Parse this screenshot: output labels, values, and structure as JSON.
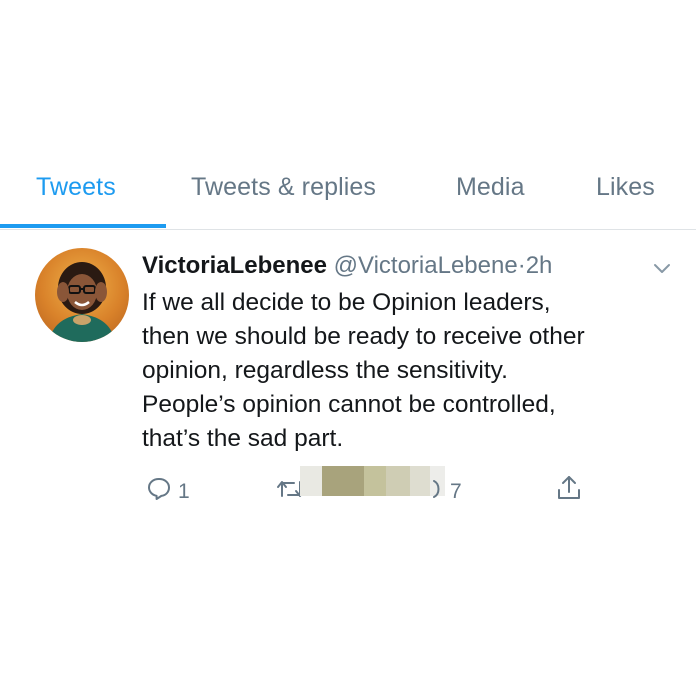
{
  "tabs": [
    {
      "label": "Tweets",
      "active": true
    },
    {
      "label": "Tweets & replies",
      "active": false
    },
    {
      "label": "Media",
      "active": false
    },
    {
      "label": "Likes",
      "active": false
    }
  ],
  "tweet": {
    "display_name": "VictoriaLebenee",
    "handle": "@VictoriaLebene",
    "separator": "·",
    "time": "2h",
    "text_lines": [
      "If we all decide to be Opinion leaders,",
      "then we should be ready to receive other",
      "opinion, regardless the sensitivity.",
      "People’s opinion cannot be controlled,",
      "that’s the sad part."
    ],
    "actions": {
      "reply_count": "1",
      "like_count": "7"
    }
  },
  "colors": {
    "accent": "#1d9bf0",
    "muted": "#657786",
    "text": "#14171a"
  },
  "icons": [
    "reply-icon",
    "retweet-icon",
    "like-icon",
    "share-icon",
    "chevron-down-icon"
  ]
}
